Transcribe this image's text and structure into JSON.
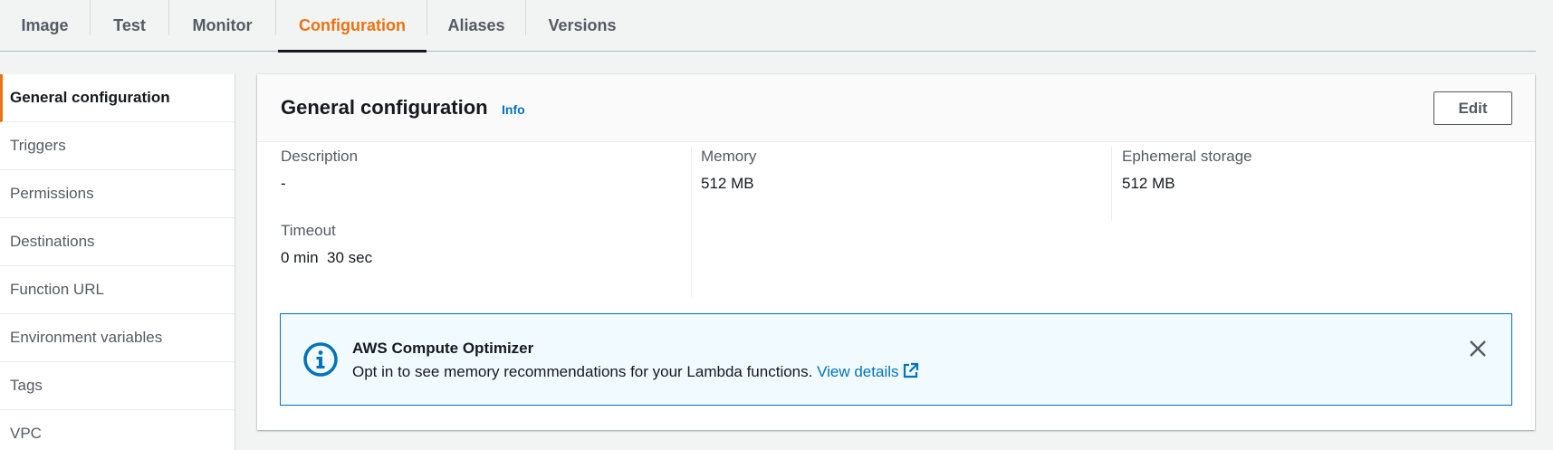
{
  "tabs": [
    {
      "label": "Image"
    },
    {
      "label": "Test"
    },
    {
      "label": "Monitor"
    },
    {
      "label": "Configuration",
      "active": true
    },
    {
      "label": "Aliases"
    },
    {
      "label": "Versions"
    }
  ],
  "sidebar": {
    "items": [
      {
        "label": "General configuration",
        "active": true
      },
      {
        "label": "Triggers"
      },
      {
        "label": "Permissions"
      },
      {
        "label": "Destinations"
      },
      {
        "label": "Function URL"
      },
      {
        "label": "Environment variables"
      },
      {
        "label": "Tags"
      },
      {
        "label": "VPC"
      }
    ]
  },
  "panel": {
    "title": "General configuration",
    "info_label": "Info",
    "edit_label": "Edit",
    "fields": {
      "description": {
        "label": "Description",
        "value": "-"
      },
      "timeout": {
        "label": "Timeout",
        "value": "0 min  30 sec"
      },
      "memory": {
        "label": "Memory",
        "value": "512 MB"
      },
      "ephemeral_storage": {
        "label": "Ephemeral storage",
        "value": "512 MB"
      }
    }
  },
  "alert": {
    "title": "AWS Compute Optimizer",
    "text": "Opt in to see memory recommendations for your Lambda functions.",
    "link_label": "View details",
    "icon": "info-circle-icon",
    "close_icon": "close-icon"
  },
  "colors": {
    "accent": "#ec7211",
    "link": "#0073bb",
    "alert_bg": "#f1faff",
    "page_bg": "#f2f3f3"
  }
}
